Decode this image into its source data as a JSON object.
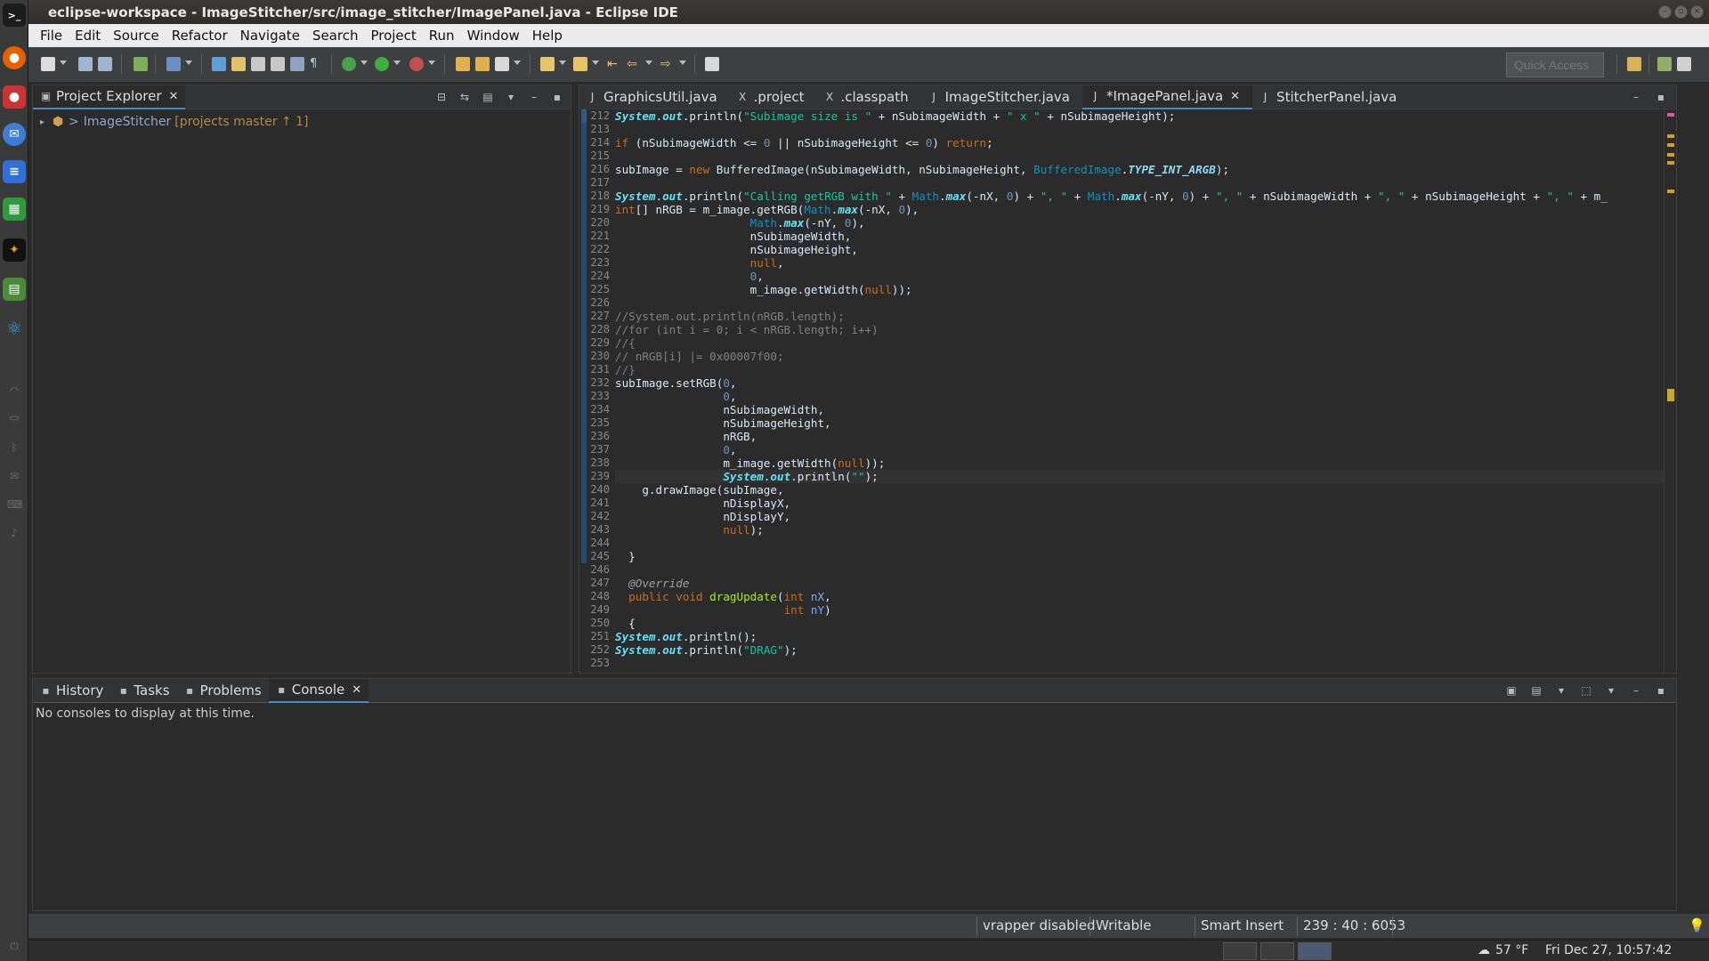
{
  "window": {
    "title": "eclipse-workspace - ImageStitcher/src/image_stitcher/ImagePanel.java - Eclipse IDE"
  },
  "menu": [
    "File",
    "Edit",
    "Source",
    "Refactor",
    "Navigate",
    "Search",
    "Project",
    "Run",
    "Window",
    "Help"
  ],
  "toolbar": {
    "quick_access_placeholder": "Quick Access"
  },
  "explorer": {
    "tab_label": "Project Explorer",
    "project_prefix": ">",
    "project_name": "ImageStitcher",
    "project_git": "[projects master ↑ 1]"
  },
  "editor": {
    "tabs": [
      {
        "label": "GraphicsUtil.java",
        "icon": "java-file-icon",
        "active": false
      },
      {
        "label": ".project",
        "icon": "xml-file-icon",
        "active": false
      },
      {
        "label": ".classpath",
        "icon": "xml-file-icon",
        "active": false
      },
      {
        "label": "ImageStitcher.java",
        "icon": "java-file-icon",
        "active": false
      },
      {
        "label": "*ImagePanel.java",
        "icon": "java-file-icon",
        "active": true
      },
      {
        "label": "StitcherPanel.java",
        "icon": "java-file-icon",
        "active": false
      }
    ],
    "lines": [
      {
        "n": "212",
        "t": [
          [
            "fld",
            "System"
          ],
          [
            "plain",
            "."
          ],
          [
            "fld",
            "out"
          ],
          [
            "plain",
            ".println("
          ],
          [
            "str",
            "\"Subimage size is \""
          ],
          [
            "plain",
            " + nSubimageWidth + "
          ],
          [
            "str",
            "\" x \""
          ],
          [
            "plain",
            " + nSubimageHeight);"
          ]
        ]
      },
      {
        "n": "213",
        "t": []
      },
      {
        "n": "214",
        "t": [
          [
            "kw",
            "if"
          ],
          [
            "plain",
            " (nSubimageWidth <= "
          ],
          [
            "num",
            "0"
          ],
          [
            "plain",
            " || nSubimageHeight <= "
          ],
          [
            "num",
            "0"
          ],
          [
            "plain",
            ") "
          ],
          [
            "kw",
            "return"
          ],
          [
            "plain",
            ";"
          ]
        ]
      },
      {
        "n": "215",
        "t": []
      },
      {
        "n": "216",
        "t": [
          [
            "plain",
            "subImage = "
          ],
          [
            "kw",
            "new"
          ],
          [
            "plain",
            " BufferedImage(nSubimageWidth, nSubimageHeight, "
          ],
          [
            "cls",
            "BufferedImage"
          ],
          [
            "plain",
            "."
          ],
          [
            "cst",
            "TYPE_INT_ARGB"
          ],
          [
            "plain",
            ");"
          ]
        ]
      },
      {
        "n": "217",
        "t": []
      },
      {
        "n": "218",
        "t": [
          [
            "fld",
            "System"
          ],
          [
            "plain",
            "."
          ],
          [
            "fld",
            "out"
          ],
          [
            "plain",
            ".println("
          ],
          [
            "str",
            "\"Calling getRGB with \""
          ],
          [
            "plain",
            " + "
          ],
          [
            "cls",
            "Math"
          ],
          [
            "plain",
            "."
          ],
          [
            "fld",
            "max"
          ],
          [
            "plain",
            "(-nX, "
          ],
          [
            "num",
            "0"
          ],
          [
            "plain",
            ") + "
          ],
          [
            "str",
            "\", \""
          ],
          [
            "plain",
            " + "
          ],
          [
            "cls",
            "Math"
          ],
          [
            "plain",
            "."
          ],
          [
            "fld",
            "max"
          ],
          [
            "plain",
            "(-nY, "
          ],
          [
            "num",
            "0"
          ],
          [
            "plain",
            ") + "
          ],
          [
            "str",
            "\", \""
          ],
          [
            "plain",
            " + nSubimageWidth + "
          ],
          [
            "str",
            "\", \""
          ],
          [
            "plain",
            " + nSubimageHeight + "
          ],
          [
            "str",
            "\", \""
          ],
          [
            "plain",
            " + m_"
          ]
        ]
      },
      {
        "n": "219",
        "t": [
          [
            "kw",
            "int"
          ],
          [
            "plain",
            "[] nRGB = m_image.getRGB("
          ],
          [
            "cls",
            "Math"
          ],
          [
            "plain",
            "."
          ],
          [
            "fld",
            "max"
          ],
          [
            "plain",
            "(-nX, "
          ],
          [
            "num",
            "0"
          ],
          [
            "plain",
            "),"
          ]
        ]
      },
      {
        "n": "220",
        "t": [
          [
            "plain",
            "                    "
          ],
          [
            "cls",
            "Math"
          ],
          [
            "plain",
            "."
          ],
          [
            "fld",
            "max"
          ],
          [
            "plain",
            "(-nY, "
          ],
          [
            "num",
            "0"
          ],
          [
            "plain",
            "),"
          ]
        ]
      },
      {
        "n": "221",
        "t": [
          [
            "plain",
            "                    nSubimageWidth,"
          ]
        ]
      },
      {
        "n": "222",
        "t": [
          [
            "plain",
            "                    nSubimageHeight,"
          ]
        ]
      },
      {
        "n": "223",
        "t": [
          [
            "plain",
            "                    "
          ],
          [
            "kw",
            "null"
          ],
          [
            "plain",
            ","
          ]
        ]
      },
      {
        "n": "224",
        "t": [
          [
            "plain",
            "                    "
          ],
          [
            "num",
            "0"
          ],
          [
            "plain",
            ","
          ]
        ]
      },
      {
        "n": "225",
        "t": [
          [
            "plain",
            "                    m_image.getWidth("
          ],
          [
            "kw",
            "null"
          ],
          [
            "plain",
            "));"
          ]
        ]
      },
      {
        "n": "226",
        "t": []
      },
      {
        "n": "227",
        "t": [
          [
            "cmt",
            "//System.out.println(nRGB.length);"
          ]
        ]
      },
      {
        "n": "228",
        "t": [
          [
            "cmt",
            "//for (int i = 0; i < nRGB.length; i++)"
          ]
        ]
      },
      {
        "n": "229",
        "t": [
          [
            "cmt",
            "//{"
          ]
        ]
      },
      {
        "n": "230",
        "t": [
          [
            "cmt",
            "// nRGB[i] |= 0x00007f00;"
          ]
        ]
      },
      {
        "n": "231",
        "t": [
          [
            "cmt",
            "//}"
          ]
        ]
      },
      {
        "n": "232",
        "t": [
          [
            "plain",
            "subImage.setRGB("
          ],
          [
            "num",
            "0"
          ],
          [
            "plain",
            ","
          ]
        ]
      },
      {
        "n": "233",
        "t": [
          [
            "plain",
            "                "
          ],
          [
            "num",
            "0"
          ],
          [
            "plain",
            ","
          ]
        ]
      },
      {
        "n": "234",
        "t": [
          [
            "plain",
            "                nSubimageWidth,"
          ]
        ]
      },
      {
        "n": "235",
        "t": [
          [
            "plain",
            "                nSubimageHeight,"
          ]
        ]
      },
      {
        "n": "236",
        "t": [
          [
            "plain",
            "                nRGB,"
          ]
        ]
      },
      {
        "n": "237",
        "t": [
          [
            "plain",
            "                "
          ],
          [
            "num",
            "0"
          ],
          [
            "plain",
            ","
          ]
        ]
      },
      {
        "n": "238",
        "t": [
          [
            "plain",
            "                m_image.getWidth("
          ],
          [
            "kw",
            "null"
          ],
          [
            "plain",
            "));"
          ]
        ]
      },
      {
        "n": "239",
        "t": [
          [
            "plain",
            "                "
          ],
          [
            "fld",
            "System"
          ],
          [
            "plain",
            "."
          ],
          [
            "fld",
            "out"
          ],
          [
            "plain",
            ".println("
          ],
          [
            "str",
            "\"\""
          ],
          [
            "plain",
            ");"
          ]
        ],
        "cur": true
      },
      {
        "n": "240",
        "t": [
          [
            "plain",
            "    g.drawImage(subImage,"
          ]
        ]
      },
      {
        "n": "241",
        "t": [
          [
            "plain",
            "                nDisplayX,"
          ]
        ]
      },
      {
        "n": "242",
        "t": [
          [
            "plain",
            "                nDisplayY,"
          ]
        ]
      },
      {
        "n": "243",
        "t": [
          [
            "plain",
            "                "
          ],
          [
            "kw",
            "null"
          ],
          [
            "plain",
            ");"
          ]
        ]
      },
      {
        "n": "244",
        "t": []
      },
      {
        "n": "245",
        "t": [
          [
            "plain",
            "  }"
          ]
        ]
      },
      {
        "n": "246",
        "t": []
      },
      {
        "n": "247",
        "t": [
          [
            "ann",
            "  @Override"
          ]
        ]
      },
      {
        "n": "248",
        "t": [
          [
            "kw",
            "  public void "
          ],
          [
            "mth",
            "dragUpdate"
          ],
          [
            "plain",
            "("
          ],
          [
            "kw",
            "int"
          ],
          [
            "var",
            " nX"
          ],
          [
            "plain",
            ","
          ]
        ]
      },
      {
        "n": "249",
        "t": [
          [
            "plain",
            "                         "
          ],
          [
            "kw",
            "int"
          ],
          [
            "var",
            " nY"
          ],
          [
            "plain",
            ")"
          ]
        ]
      },
      {
        "n": "250",
        "t": [
          [
            "plain",
            "  {"
          ]
        ]
      },
      {
        "n": "251",
        "t": [
          [
            "fld",
            "System"
          ],
          [
            "plain",
            "."
          ],
          [
            "fld",
            "out"
          ],
          [
            "plain",
            ".println();"
          ]
        ]
      },
      {
        "n": "252",
        "t": [
          [
            "fld",
            "System"
          ],
          [
            "plain",
            "."
          ],
          [
            "fld",
            "out"
          ],
          [
            "plain",
            ".println("
          ],
          [
            "str",
            "\"DRAG\""
          ],
          [
            "plain",
            ");"
          ]
        ]
      },
      {
        "n": "253",
        "t": []
      }
    ]
  },
  "bottom": {
    "tabs": [
      {
        "label": "History",
        "icon": "history-icon",
        "active": false
      },
      {
        "label": "Tasks",
        "icon": "tasks-icon",
        "active": false
      },
      {
        "label": "Problems",
        "icon": "problems-icon",
        "active": false
      },
      {
        "label": "Console",
        "icon": "console-icon",
        "active": true
      }
    ],
    "console_message": "No consoles to display at this time."
  },
  "status": {
    "vrapper": "vrapper disabled",
    "writable": "Writable",
    "insert_mode": "Smart Insert",
    "position": "239 : 40 : 6053"
  },
  "tray": {
    "temperature": "57 °F",
    "datetime": "Fri Dec 27, 10:57:42"
  },
  "colors": {
    "accent": "#4a88c7",
    "keyword": "#cc6c1d",
    "string": "#17c6a3"
  }
}
